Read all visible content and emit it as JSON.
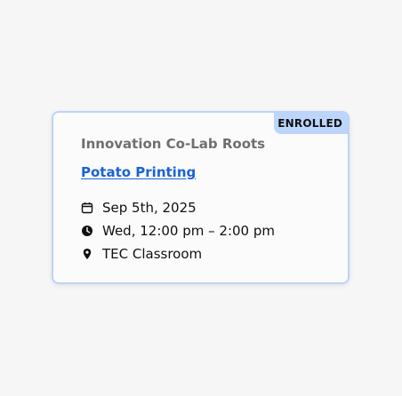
{
  "card": {
    "badge": "ENROLLED",
    "organization": "Innovation Co-Lab Roots",
    "title": "Potato Printing",
    "date": "Sep 5th, 2025",
    "time": "Wed, 12:00 pm – 2:00 pm",
    "location": "TEC Classroom"
  },
  "colors": {
    "accent": "#1a63d6",
    "badge_bg": "#bcd6fb",
    "card_border": "#bcd3f5",
    "muted_text": "#6f6f6f"
  },
  "icons": {
    "date": "calendar-icon",
    "time": "clock-icon",
    "location": "map-pin-icon"
  }
}
